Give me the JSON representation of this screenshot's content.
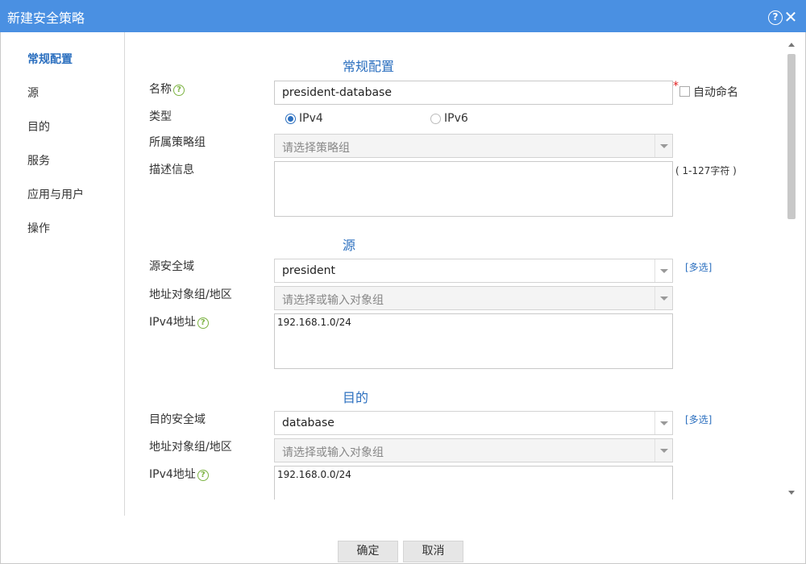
{
  "window": {
    "title": "新建安全策略",
    "help_icon": "question-circle-icon",
    "close_icon": "close-icon"
  },
  "nav": {
    "items": [
      {
        "label": "常规配置",
        "active": true
      },
      {
        "label": "源",
        "active": false
      },
      {
        "label": "目的",
        "active": false
      },
      {
        "label": "服务",
        "active": false
      },
      {
        "label": "应用与用户",
        "active": false
      },
      {
        "label": "操作",
        "active": false
      }
    ]
  },
  "general": {
    "section_title": "常规配置",
    "name_label": "名称",
    "name_value": "president-database",
    "required_mark": "*",
    "auto_name_label": "自动命名",
    "auto_name_checked": false,
    "type_label": "类型",
    "type_options": [
      {
        "label": "IPv4",
        "selected": true
      },
      {
        "label": "IPv6",
        "selected": false
      }
    ],
    "group_label": "所属策略组",
    "group_placeholder": "请选择策略组",
    "desc_label": "描述信息",
    "desc_value": "",
    "desc_hint": "( 1-127字符 )"
  },
  "source": {
    "section_title": "源",
    "zone_label": "源安全域",
    "zone_value": "president",
    "multi_label": "[多选]",
    "addr_group_label": "地址对象组/地区",
    "addr_group_placeholder": "请选择或输入对象组",
    "ipv4_label": "IPv4地址",
    "ipv4_value": "192.168.1.0/24"
  },
  "destination": {
    "section_title": "目的",
    "zone_label": "目的安全域",
    "zone_value": "database",
    "multi_label": "[多选]",
    "addr_group_label": "地址对象组/地区",
    "addr_group_placeholder": "请选择或输入对象组",
    "ipv4_label": "IPv4地址",
    "ipv4_value": "192.168.0.0/24"
  },
  "footer": {
    "ok_label": "确定",
    "cancel_label": "取消"
  },
  "colors": {
    "titlebar": "#4a90e2",
    "accent": "#2b6fbf",
    "required": "#e02020",
    "help_icon": "#7cb342"
  }
}
